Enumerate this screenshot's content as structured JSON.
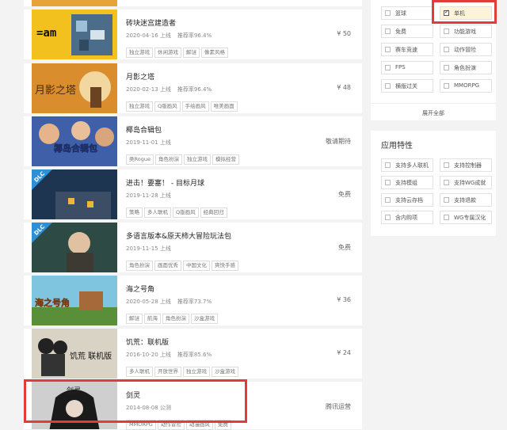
{
  "games": [
    {
      "title": "砖块迷宫建造者",
      "date": "2020-04-16 上线",
      "rate": "推荐率96.4%",
      "tags": [
        "独立游戏",
        "休闲游戏",
        "解谜",
        "像素风格"
      ],
      "price": "¥ 50"
    },
    {
      "title": "月影之塔",
      "date": "2020-02-13 上线",
      "rate": "推荐率96.4%",
      "tags": [
        "独立游戏",
        "Q版画风",
        "手绘画风",
        "唯美画面"
      ],
      "price": "¥ 48"
    },
    {
      "title": "椰岛合辑包",
      "date": "2019-11-01 上线",
      "rate": "",
      "tags": [
        "类Rogue",
        "角色扮演",
        "独立游戏",
        "模拟经营"
      ],
      "price": "敬请期待"
    },
    {
      "title": "进击！要塞！ - 目标月球",
      "date": "2019-11-28 上线",
      "rate": "",
      "tags": [
        "策略",
        "多人联机",
        "Q版画风",
        "经典回归"
      ],
      "price": "免费"
    },
    {
      "title": "多语言版本&原天柿大冒险玩法包",
      "date": "2019-11-15 上线",
      "rate": "",
      "tags": [
        "角色扮演",
        "画面优秀",
        "中国文化",
        "爽快手感"
      ],
      "price": "免费"
    },
    {
      "title": "海之号角",
      "date": "2020-05-28 上线",
      "rate": "推荐率73.7%",
      "tags": [
        "解谜",
        "航海",
        "角色扮演",
        "沙盒游戏"
      ],
      "price": "¥ 36"
    },
    {
      "title": "饥荒：联机版",
      "date": "2016-10-20 上线",
      "rate": "推荐率85.6%",
      "tags": [
        "多人联机",
        "开放世界",
        "独立游戏",
        "沙盒游戏"
      ],
      "price": "¥ 24"
    },
    {
      "title": "剑灵",
      "date": "2014-08-08 公测",
      "rate": "",
      "tags": [
        "MMORPG",
        "动作冒险",
        "动漫画风",
        "免费"
      ],
      "price": "腾讯运营"
    }
  ],
  "thumb_text": {
    "brick": "=am",
    "moon": "月影之塔",
    "coco": "椰岛合辑包",
    "dlc": "DLC",
    "horn": "海之号角",
    "dst": "饥荒 联机版",
    "blade": "剑灵"
  },
  "filters": {
    "options": [
      {
        "label": "篮球",
        "checked": false
      },
      {
        "label": "单机",
        "checked": true
      },
      {
        "label": "免费",
        "checked": false
      },
      {
        "label": "功能游戏",
        "checked": false
      },
      {
        "label": "赛车竞速",
        "checked": false
      },
      {
        "label": "动作冒险",
        "checked": false
      },
      {
        "label": "FPS",
        "checked": false
      },
      {
        "label": "角色扮演",
        "checked": false
      },
      {
        "label": "横版过关",
        "checked": false
      },
      {
        "label": "MMORPG",
        "checked": false
      }
    ],
    "expand_label": "展开全部"
  },
  "features": {
    "title": "应用特性",
    "options": [
      {
        "label": "支持多人联机"
      },
      {
        "label": "支持控制器"
      },
      {
        "label": "支持模组"
      },
      {
        "label": "支持WG成就"
      },
      {
        "label": "支持云存档"
      },
      {
        "label": "支持退款"
      },
      {
        "label": "含内购项"
      },
      {
        "label": "WG专属汉化"
      }
    ]
  },
  "colors": {
    "highlight": "#e23b3b",
    "checked_bg": "#fdf3d8"
  }
}
